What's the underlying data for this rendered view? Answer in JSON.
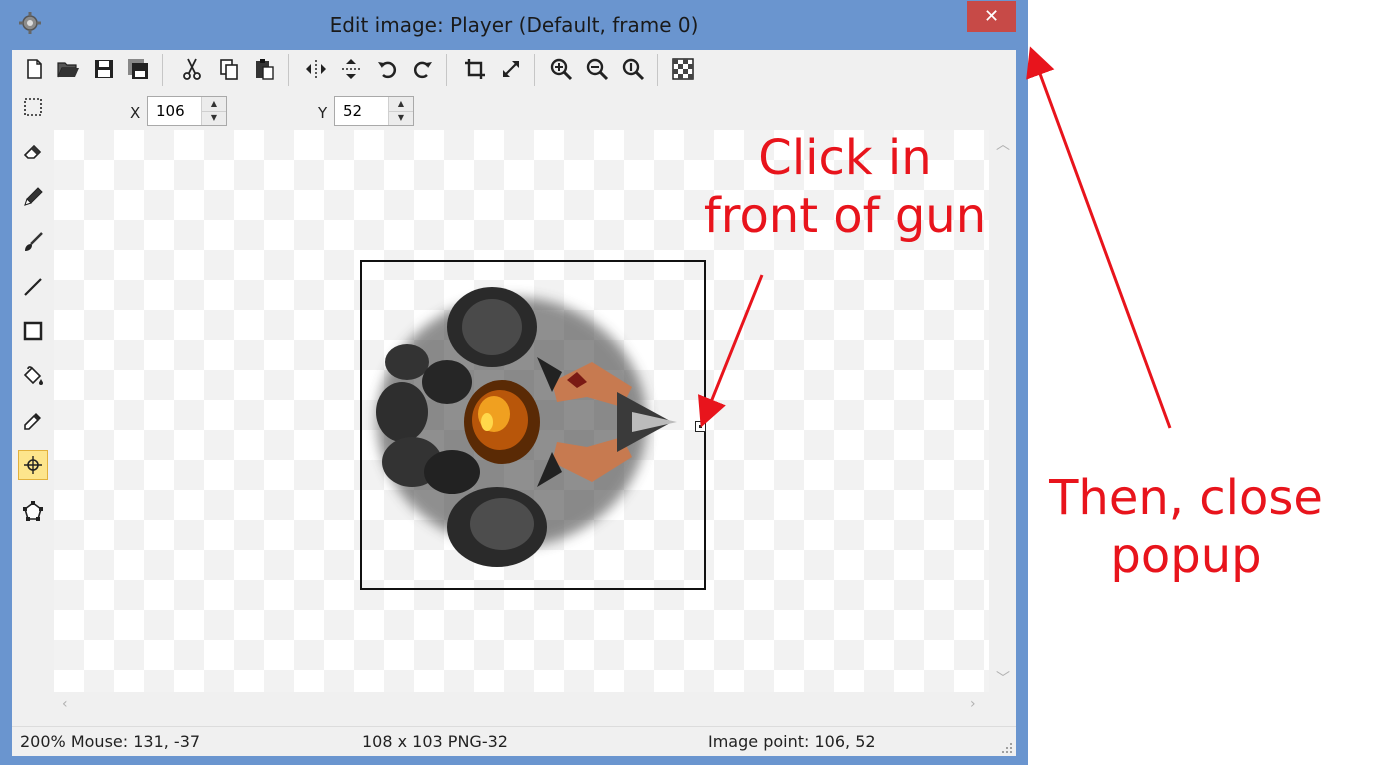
{
  "window": {
    "title": "Edit image: Player (Default, frame 0)",
    "close_label": "✕"
  },
  "toolbar": {
    "buttons": [
      "new-file-icon",
      "open-folder-icon",
      "save-icon",
      "save-all-icon",
      "cut-icon",
      "copy-icon",
      "paste-icon",
      "flip-horizontal-icon",
      "flip-vertical-icon",
      "rotate-left-icon",
      "rotate-right-icon",
      "crop-icon",
      "resize-icon",
      "zoom-in-icon",
      "zoom-out-icon",
      "zoom-actual-icon",
      "transparency-icon"
    ]
  },
  "tools": {
    "items": [
      "select-rectangle-icon",
      "eraser-icon",
      "pencil-icon",
      "brush-icon",
      "line-icon",
      "rectangle-icon",
      "fill-bucket-icon",
      "eyedropper-icon",
      "image-point-icon",
      "polygon-icon"
    ],
    "active": "image-point-icon"
  },
  "coords": {
    "x_label": "X",
    "x_value": "106",
    "y_label": "Y",
    "y_value": "52"
  },
  "status": {
    "zoom_mouse": "200%  Mouse: 131, -37",
    "size_format": "108 x 103  PNG-32",
    "image_point": "Image point: 106, 52"
  },
  "annotations": {
    "instruction_1": "Click in\nfront of gun",
    "instruction_1_line1": "Click in",
    "instruction_1_line2": "front of gun",
    "instruction_2_line1": "Then, close",
    "instruction_2_line2": "popup",
    "color": "#e8141c"
  },
  "colors": {
    "titlebar": "#6a95cf",
    "close_button": "#c74a47",
    "active_tool": "#fde58c"
  }
}
